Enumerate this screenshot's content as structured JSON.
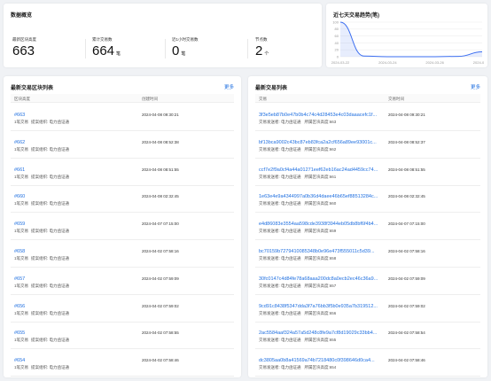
{
  "overview": {
    "title": "数据概览",
    "stats": [
      {
        "label": "最新区块高度",
        "value": "663",
        "unit": ""
      },
      {
        "label": "累计交易数",
        "value": "664",
        "unit": "笔"
      },
      {
        "label": "近1小时交易数",
        "value": "0",
        "unit": "笔"
      },
      {
        "label": "节点数",
        "value": "2",
        "unit": "个"
      }
    ]
  },
  "trend": {
    "title": "近七天交易趋势(笔)",
    "y_ticks": [
      "100",
      "80",
      "60",
      "40",
      "20",
      "0"
    ],
    "x_ticks": [
      "2024-03-22",
      "2024-03-24",
      "2024-03-26",
      "2024-03-28"
    ]
  },
  "chart_data": {
    "type": "area",
    "title": "近七天交易趋势(笔)",
    "x": [
      "2024-03-22",
      "2024-03-23",
      "2024-03-24",
      "2024-03-25",
      "2024-03-26",
      "2024-03-27",
      "2024-03-28"
    ],
    "y": [
      100,
      2,
      0,
      0,
      0,
      1,
      14
    ],
    "ylim": [
      0,
      100
    ],
    "grid": true,
    "color": "#3a6df0"
  },
  "blocks": {
    "title": "最新交易区块列表",
    "more": "更多",
    "col_height": "区块高度",
    "col_time": "创建时间",
    "rows": [
      {
        "id": "#663",
        "tx": "1笔交易",
        "org": "提案组织: 电力函证通",
        "time": "2024-04-08 09:30:21"
      },
      {
        "id": "#662",
        "tx": "1笔交易",
        "org": "提案组织: 电力函证通",
        "time": "2024-04-08 08:52:38"
      },
      {
        "id": "#661",
        "tx": "1笔交易",
        "org": "提案组织: 电力函证通",
        "time": "2024-04-08 08:51:55"
      },
      {
        "id": "#660",
        "tx": "1笔交易",
        "org": "提案组织: 电力函证通",
        "time": "2024-04-08 02:32:45"
      },
      {
        "id": "#659",
        "tx": "1笔交易",
        "org": "提案组织: 电力函证通",
        "time": "2024-04-07 07:15:00"
      },
      {
        "id": "#658",
        "tx": "1笔交易",
        "org": "提案组织: 电力函证通",
        "time": "2024-04-02 07:58:16"
      },
      {
        "id": "#657",
        "tx": "1笔交易",
        "org": "提案组织: 电力函证通",
        "time": "2024-04-02 07:59:09"
      },
      {
        "id": "#656",
        "tx": "1笔交易",
        "org": "提案组织: 电力函证通",
        "time": "2024-04-02 07:59:02"
      },
      {
        "id": "#655",
        "tx": "1笔交易",
        "org": "提案组织: 电力函证通",
        "time": "2024-04-02 07:58:55"
      },
      {
        "id": "#654",
        "tx": "1笔交易",
        "org": "提案组织: 电力函证通",
        "time": "2024-04-02 07:58:46"
      }
    ]
  },
  "txs": {
    "title": "最新交易列表",
    "more": "更多",
    "col_tx": "交易",
    "col_time": "交易时间",
    "rows": [
      {
        "hash": "3f3e5eb87b0e47b0b4c74c4d28453e4c03daaacefc1f...",
        "sender": "交易发送者: 电力函证通",
        "block": "所属区块高度:663",
        "time": "2024-04-08 09:30:21"
      },
      {
        "hash": "bf13bca9002c43bc87eb83fca2a2cf656a89ee93001c...",
        "sender": "交易发送者: 电力函证通",
        "block": "所属区块高度:662",
        "time": "2024-04-08 08:52:37"
      },
      {
        "hash": "ccf7e2f9a0cf4a44a01271eef62eb16ac24ad4459cc74...",
        "sender": "交易发送者: 电力函证通",
        "block": "所属区块高度:661",
        "time": "2024-04-08 08:51:55"
      },
      {
        "hash": "1e63e4e9a4344997a0b36d4daee46b65ef88513284c...",
        "sender": "交易发送者: 电力函证通",
        "block": "所属区块高度:660",
        "time": "2024-04-08 02:32:45"
      },
      {
        "hash": "e4d86083e3554aa598cde3938f3944eb05db8bf6f4b4...",
        "sender": "交易发送者: 电力函证通",
        "block": "所属区块高度:659",
        "time": "2024-04-07 07:15:00"
      },
      {
        "hash": "bc70159b7279410085348b0e96e473f555011c5d39...",
        "sender": "交易发送者: 电力函证通",
        "block": "所属区块高度:658",
        "time": "2024-04-02 07:58:16"
      },
      {
        "hash": "30fc0147c4d84fe78a68aaa200dc8a0ecb2ec46c36a9...",
        "sender": "交易发送者: 电力函证通",
        "block": "所属区块高度:657",
        "time": "2024-04-02 07:59:09"
      },
      {
        "hash": "9cd91c8438f5347dda3f7a76bb3f5b0e935a7b319512...",
        "sender": "交易发送者: 电力函证通",
        "block": "所属区块高度:656",
        "time": "2024-04-02 07:59:02"
      },
      {
        "hash": "2ac5584aaf324a57a5d248c8fe9a7cf8d19029c33bb4...",
        "sender": "交易发送者: 电力函证通",
        "block": "所属区块高度:655",
        "time": "2024-04-02 07:58:54"
      },
      {
        "hash": "dc3805aa0b8a41569a74b7218480c0f398646d0ca4...",
        "sender": "交易发送者: 电力函证通",
        "block": "所属区块高度:654",
        "time": "2024-04-02 07:58:46"
      }
    ]
  }
}
